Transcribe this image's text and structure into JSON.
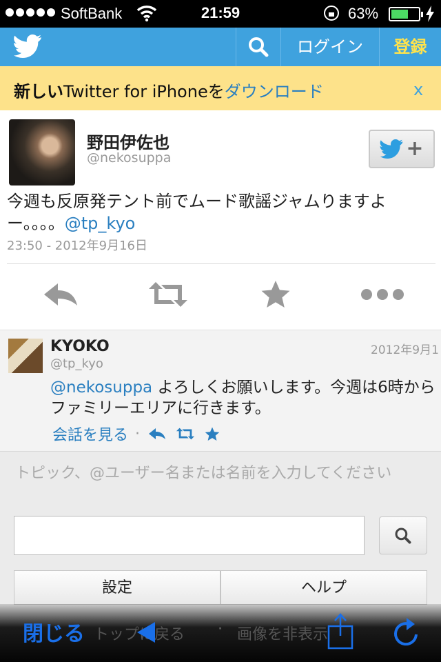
{
  "status_bar": {
    "carrier": "SoftBank",
    "time": "21:59",
    "battery_percent": "63%",
    "battery_level": 0.63
  },
  "header": {
    "logo_icon": "twitter-bird-icon",
    "search_icon": "search-icon",
    "login_label": "ログイン",
    "signup_label": "登録",
    "brand_color": "#3fa2de",
    "signup_color": "#ffe34d"
  },
  "banner": {
    "text_bold": "新しい",
    "text_plain": "Twitter for iPhoneを",
    "text_link": "ダウンロード",
    "close_label": "x",
    "background": "#fde28a"
  },
  "tweet": {
    "name": "野田伊佐也",
    "handle": "@nekosuppa",
    "text": "今週も反原発テント前でムード歌謡ジャムりますよー。。。。",
    "mention": "@tp_kyo",
    "timestamp": "23:50 - 2012年9月16日",
    "follow_icon": "follow-plus-icon",
    "actions": [
      "reply-icon",
      "retweet-icon",
      "favorite-icon",
      "more-icon"
    ]
  },
  "reply": {
    "name": "KYOKO",
    "handle": "@tp_kyo",
    "date": "2012年9月1",
    "mention": "@nekosuppa",
    "text": " よろしくお願いします。今週は6時からファミリーエリアに行きます。",
    "conversation_link": "会話を見る"
  },
  "search": {
    "placeholder_hint": "トピック、@ユーザー名または名前を入力してください",
    "input_value": "",
    "settings_label": "設定",
    "help_label": "ヘルプ"
  },
  "toolbar": {
    "close_label": "閉じる",
    "back_to_top_label": "トップに戻る",
    "separator": "·",
    "hide_images_label": "画像を非表示"
  }
}
